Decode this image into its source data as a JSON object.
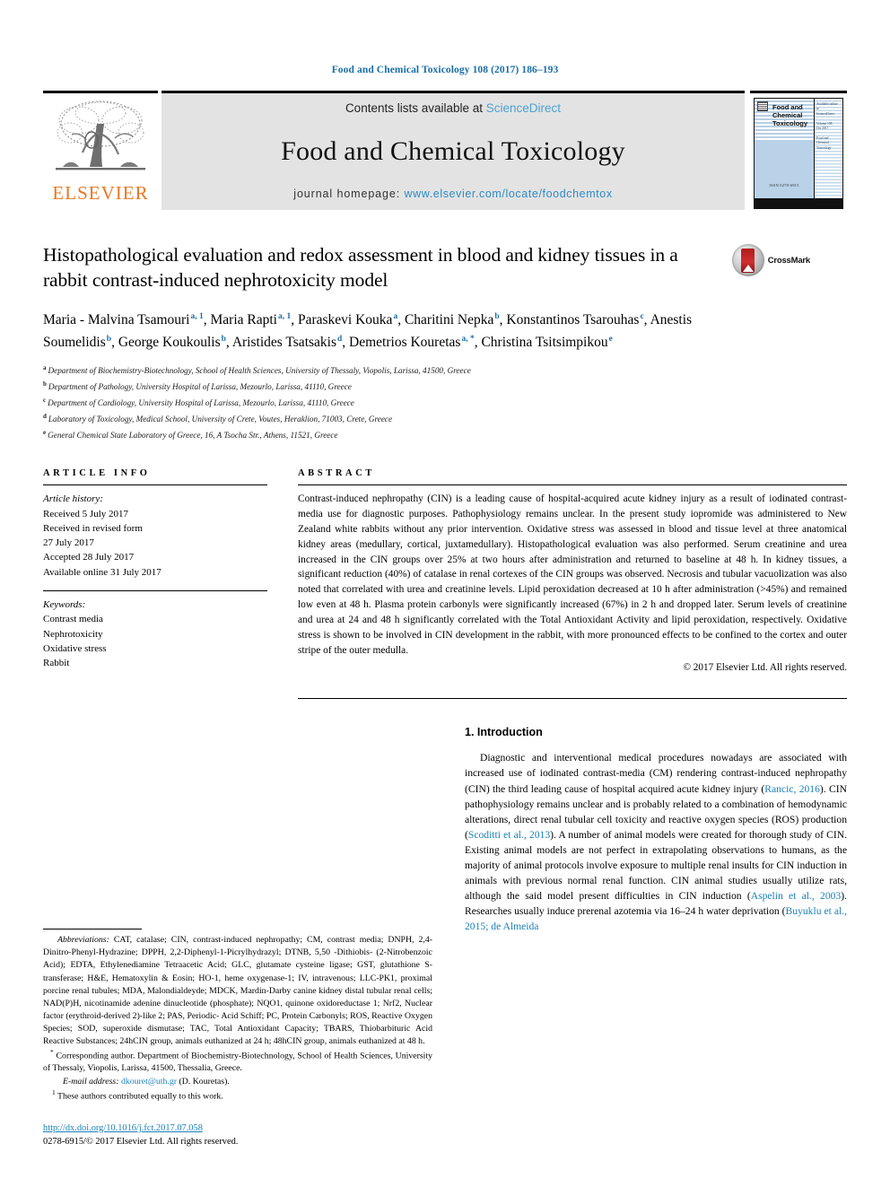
{
  "running_head": "Food and Chemical Toxicology 108 (2017) 186–193",
  "masthead": {
    "publisher_name": "ELSEVIER",
    "contents_prefix": "Contents lists available at ",
    "contents_link": "ScienceDirect",
    "journal_title": "Food and Chemical Toxicology",
    "homepage_prefix": "journal homepage: ",
    "homepage_url": "www.elsevier.com/locate/foodchemtox",
    "cover": {
      "journal_name": "Food and\nChemical\nToxicology",
      "issn_text": "ISSN 0278-6915",
      "sidebar_text": "Available online at\nwww.sciencedirect.com\n\nScienceDirect\n\nVolume 108\nOctober 2017\nISSN 0278-6915\n\nFood and\nChemical\nToxicology"
    }
  },
  "article": {
    "title": "Histopathological evaluation and redox assessment in blood and kidney tissues in a rabbit contrast-induced nephrotoxicity model",
    "crossmark_label": "CrossMark",
    "authors": [
      {
        "name": "Maria - Malvina Tsamouri",
        "marks": "a, 1",
        "sep": ", "
      },
      {
        "name": "Maria Rapti",
        "marks": "a, 1",
        "sep": ", "
      },
      {
        "name": "Paraskevi Kouka",
        "marks": "a",
        "sep": ", "
      },
      {
        "name": "Charitini Nepka",
        "marks": "b",
        "sep": ", "
      },
      {
        "name": "Konstantinos Tsarouhas",
        "marks": "c",
        "sep": ", "
      },
      {
        "name": "Anestis Soumelidis",
        "marks": "b",
        "sep": ", "
      },
      {
        "name": "George Koukoulis",
        "marks": "b",
        "sep": ", "
      },
      {
        "name": "Aristides Tsatsakis",
        "marks": "d",
        "sep": ", "
      },
      {
        "name": "Demetrios Kouretas",
        "marks": "a, *",
        "sep": ", "
      },
      {
        "name": "Christina Tsitsimpikou",
        "marks": "e",
        "sep": ""
      }
    ],
    "affiliations": [
      {
        "mark": "a",
        "text": "Department of Biochemistry-Biotechnology, School of Health Sciences, University of Thessaly, Viopolis, Larissa, 41500, Greece"
      },
      {
        "mark": "b",
        "text": "Department of Pathology, University Hospital of Larissa, Mezourlo, Larissa, 41110, Greece"
      },
      {
        "mark": "c",
        "text": "Department of Cardiology, University Hospital of Larissa, Mezourlo, Larissa, 41110, Greece"
      },
      {
        "mark": "d",
        "text": "Laboratory of Toxicology, Medical School, University of Crete, Voutes, Heraklion, 71003, Crete, Greece"
      },
      {
        "mark": "e",
        "text": "General Chemical State Laboratory of Greece, 16, A Tsocha Str., Athens, 11521, Greece"
      }
    ]
  },
  "article_info": {
    "label": "ARTICLE INFO",
    "history_title": "Article history:",
    "history": [
      "Received 5 July 2017",
      "Received in revised form",
      "27 July 2017",
      "Accepted 28 July 2017",
      "Available online 31 July 2017"
    ],
    "keywords_title": "Keywords:",
    "keywords": [
      "Contrast media",
      "Nephrotoxicity",
      "Oxidative stress",
      "Rabbit"
    ]
  },
  "abstract": {
    "label": "ABSTRACT",
    "text": "Contrast-induced nephropathy (CIN) is a leading cause of hospital-acquired acute kidney injury as a result of iodinated contrast-media use for diagnostic purposes. Pathophysiology remains unclear. In the present study iopromide was administered to New Zealand white rabbits without any prior intervention. Oxidative stress was assessed in blood and tissue level at three anatomical kidney areas (medullary, cortical, juxtamedullary). Histopathological evaluation was also performed. Serum creatinine and urea increased in the CIN groups over 25% at two hours after administration and returned to baseline at 48 h. In kidney tissues, a significant reduction (40%) of catalase in renal cortexes of the CIN groups was observed. Necrosis and tubular vacuolization was also noted that correlated with urea and creatinine levels. Lipid peroxidation decreased at 10 h after administration (>45%) and remained low even at 48 h. Plasma protein carbonyls were significantly increased (67%) in 2 h and dropped later. Serum levels of creatinine and urea at 24 and 48 h significantly correlated with the Total Antioxidant Activity and lipid peroxidation, respectively. Oxidative stress is shown to be involved in CIN development in the rabbit, with more pronounced effects to be confined to the cortex and outer stripe of the outer medulla.",
    "copyright": "© 2017 Elsevier Ltd. All rights reserved."
  },
  "introduction": {
    "heading": "1. Introduction",
    "paragraph_parts": [
      {
        "type": "text",
        "value": "Diagnostic and interventional medical procedures nowadays are associated with increased use of iodinated contrast-media (CM) rendering contrast-induced nephropathy (CIN) the third leading cause of hospital acquired acute kidney injury ("
      },
      {
        "type": "cite",
        "value": "Rancic, 2016"
      },
      {
        "type": "text",
        "value": "). CIN pathophysiology remains unclear and is probably related to a combination of hemodynamic alterations, direct renal tubular cell toxicity and reactive oxygen species (ROS) production ("
      },
      {
        "type": "cite",
        "value": "Scoditti et al., 2013"
      },
      {
        "type": "text",
        "value": "). A number of animal models were created for thorough study of CIN. Existing animal models are not perfect in extrapolating observations to humans, as the majority of animal protocols involve exposure to multiple renal insults for CIN induction in animals with previous normal renal function. CIN animal studies usually utilize rats, although the said model present difficulties in CIN induction ("
      },
      {
        "type": "cite",
        "value": "Aspelin et al., 2003"
      },
      {
        "type": "text",
        "value": "). Researches usually induce prerenal azotemia via 16–24 h water deprivation ("
      },
      {
        "type": "cite",
        "value": "Buyuklu et al., 2015; de Almeida"
      }
    ]
  },
  "footnotes": {
    "abbreviations_title": "Abbreviations:",
    "abbreviations_text": " CAT, catalase; CIN, contrast-induced nephropathy; CM, contrast media; DNPH, 2,4-Dinitro-Phenyl-Hydrazine; DPPH, 2,2-Diphenyl-1-Picrylhydrazyl; DTNB, 5,50 -Dithiobis- (2-Nitrobenzoic Acid); EDTA, Ethylenediamine Tetraacetic Acid; GLC, glutamate cysteine ligase; GST, glutathione S-transferase; H&E, Hematoxylin & Eosin; HO-1, heme oxygenase-1; IV, intravenous; LLC-PK1, proximal porcine renal tubules; MDA, Malondialdeyde; MDCK, Mardin-Darby canine kidney distal tubular renal cells; NAD(P)H, nicotinamide adenine dinucleotide (phosphate); NQO1, quinone oxidoreductase 1; Nrf2, Nuclear factor (erythroid-derived 2)-like 2; PAS, Periodic- Acid Schiff; PC, Protein Carbonyls; ROS, Reactive Oxygen Species; SOD, superoxide dismutase; TAC, Total Antioxidant Capacity; TBARS, Thiobarbituric Acid Reactive Substances; 24hCIN group, animals euthanized at 24 h; 48hCIN group, animals euthanized at 48 h.",
    "corresponding_marker": "*",
    "corresponding_text": " Corresponding author. Department of Biochemistry-Biotechnology, School of Health Sciences, University of Thessaly, Viopolis, Larissa, 41500, Thessalia, Greece.",
    "email_label": "E-mail address:",
    "email_link": "dkouret@uth.gr",
    "email_suffix": " (D. Kouretas).",
    "equal_marker": "1",
    "equal_text": " These authors contributed equally to this work."
  },
  "page_footer": {
    "doi": "http://dx.doi.org/10.1016/j.fct.2017.07.058",
    "issn_line": "0278-6915/© 2017 Elsevier Ltd. All rights reserved."
  },
  "colors": {
    "link_blue": "#1a7fb8",
    "header_blue": "#1a6fa8",
    "sciencedirect_blue": "#4ba3d3",
    "elsevier_orange": "#e87722",
    "masthead_grey": "#e3e3e3",
    "cover_blue": "#b9d2e8"
  }
}
